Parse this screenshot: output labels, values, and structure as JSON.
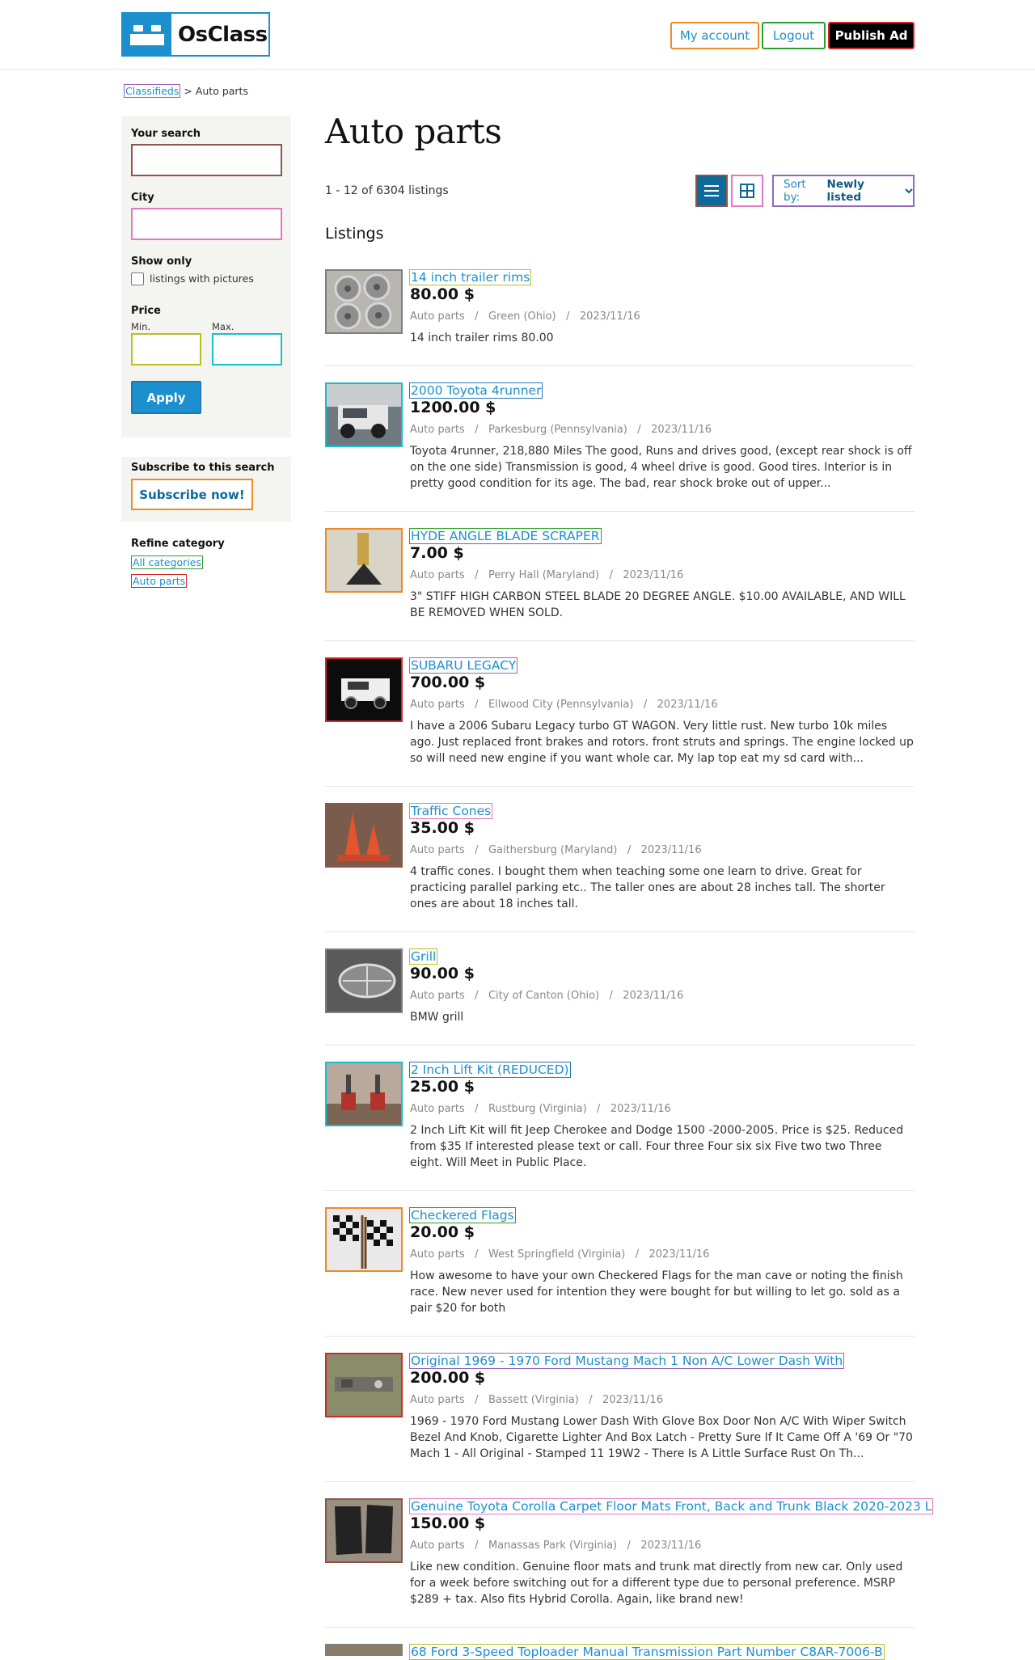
{
  "header": {
    "logo_text": "OsClass",
    "my_account": "My account",
    "logout": "Logout",
    "publish": "Publish Ad"
  },
  "breadcrumb": {
    "root": "Classifieds",
    "separator": ">",
    "current": "Auto parts"
  },
  "sidebar": {
    "search_label": "Your search",
    "city_label": "City",
    "show_only_label": "Show only",
    "pictures_label": "listings with pictures",
    "price_label": "Price",
    "min_label": "Min.",
    "max_label": "Max.",
    "apply": "Apply",
    "subscribe_label": "Subscribe to this search",
    "subscribe_button": "Subscribe now!",
    "refine_label": "Refine category",
    "all_categories": "All categories",
    "auto_parts": "Auto parts"
  },
  "main": {
    "title": "Auto parts",
    "count": "1 - 12 of 6304 listings",
    "listings_heading": "Listings",
    "sort_prefix": "Sort by:",
    "sort_value": "Newly listed"
  },
  "listings": [
    {
      "title": "14 inch trailer rims",
      "price": "80.00 $",
      "category": "Auto parts",
      "location": "Green (Ohio)",
      "date": "2023/11/16",
      "desc": "14 inch trailer rims 80.00"
    },
    {
      "title": "2000 Toyota 4runner",
      "price": "1200.00 $",
      "category": "Auto parts",
      "location": "Parkesburg (Pennsylvania)",
      "date": "2023/11/16",
      "desc": "Toyota 4runner, 218,880 Miles The good, Runs and drives good, (except rear shock is off on the one side) Transmission is good, 4 wheel drive is good. Good tires. Interior is in pretty good condition for its age. The bad, rear shock broke out of upper..."
    },
    {
      "title": "HYDE ANGLE BLADE SCRAPER",
      "price": "7.00 $",
      "category": "Auto parts",
      "location": "Perry Hall (Maryland)",
      "date": "2023/11/16",
      "desc": "3\" STIFF HIGH CARBON STEEL BLADE 20 DEGREE ANGLE. $10.00 AVAILABLE, AND WILL BE REMOVED WHEN SOLD."
    },
    {
      "title": "SUBARU LEGACY",
      "price": "700.00 $",
      "category": "Auto parts",
      "location": "Ellwood City (Pennsylvania)",
      "date": "2023/11/16",
      "desc": "I have a 2006 Subaru Legacy turbo GT WAGON. Very little rust. New turbo 10k miles ago. Just replaced front brakes and rotors. front struts and springs. The engine locked up so will need new engine if you want whole car. My lap top eat my sd card with..."
    },
    {
      "title": "Traffic Cones",
      "price": "35.00 $",
      "category": "Auto parts",
      "location": "Gaithersburg (Maryland)",
      "date": "2023/11/16",
      "desc": "4 traffic cones. I bought them when teaching some one learn to drive. Great for practicing parallel parking etc.. The taller ones are about 28 inches tall. The shorter ones are about 18 inches tall."
    },
    {
      "title": "Grill",
      "price": "90.00 $",
      "category": "Auto parts",
      "location": "City of Canton (Ohio)",
      "date": "2023/11/16",
      "desc": "BMW grill"
    },
    {
      "title": "2 Inch Lift Kit (REDUCED)",
      "price": "25.00 $",
      "category": "Auto parts",
      "location": "Rustburg (Virginia)",
      "date": "2023/11/16",
      "desc": "2 Inch Lift Kit will fit Jeep Cherokee and Dodge 1500 -2000-2005. Price is $25. Reduced from $35 If interested please text or call. Four three Four six six Five two two Three eight. Will Meet in Public Place."
    },
    {
      "title": "Checkered Flags",
      "price": "20.00 $",
      "category": "Auto parts",
      "location": "West Springfield (Virginia)",
      "date": "2023/11/16",
      "desc": "How awesome to have your own Checkered Flags for the man cave or noting the finish race. New never used for intention they were bought for but willing to let go. sold as a pair $20 for both"
    },
    {
      "title": "Original 1969 - 1970 Ford Mustang Mach 1 Non A/C Lower Dash With",
      "price": "200.00 $",
      "category": "Auto parts",
      "location": "Bassett (Virginia)",
      "date": "2023/11/16",
      "desc": "1969 - 1970 Ford Mustang Lower Dash With Glove Box Door Non A/C With Wiper Switch Bezel And Knob, Cigarette Lighter And Box Latch - Pretty Sure If It Came Off A '69 Or \"70 Mach 1 - All Original - Stamped 11 19W2 - There Is A Little Surface Rust On Th..."
    },
    {
      "title": "Genuine Toyota Corolla Carpet Floor Mats Front, Back and Trunk Black 2020-2023 L",
      "price": "150.00 $",
      "category": "Auto parts",
      "location": "Manassas Park (Virginia)",
      "date": "2023/11/16",
      "desc": "Like new condition. Genuine floor mats and trunk mat directly from new car. Only used for a week before switching out for a different type due to personal preference. MSRP $289 + tax. Also fits Hybrid Corolla. Again, like brand new!"
    },
    {
      "title": "68 Ford 3-Speed Toploader Manual Transmission Part Number C8AR-7006-B",
      "price": "",
      "category": "",
      "location": "",
      "date": "",
      "desc": ""
    }
  ]
}
